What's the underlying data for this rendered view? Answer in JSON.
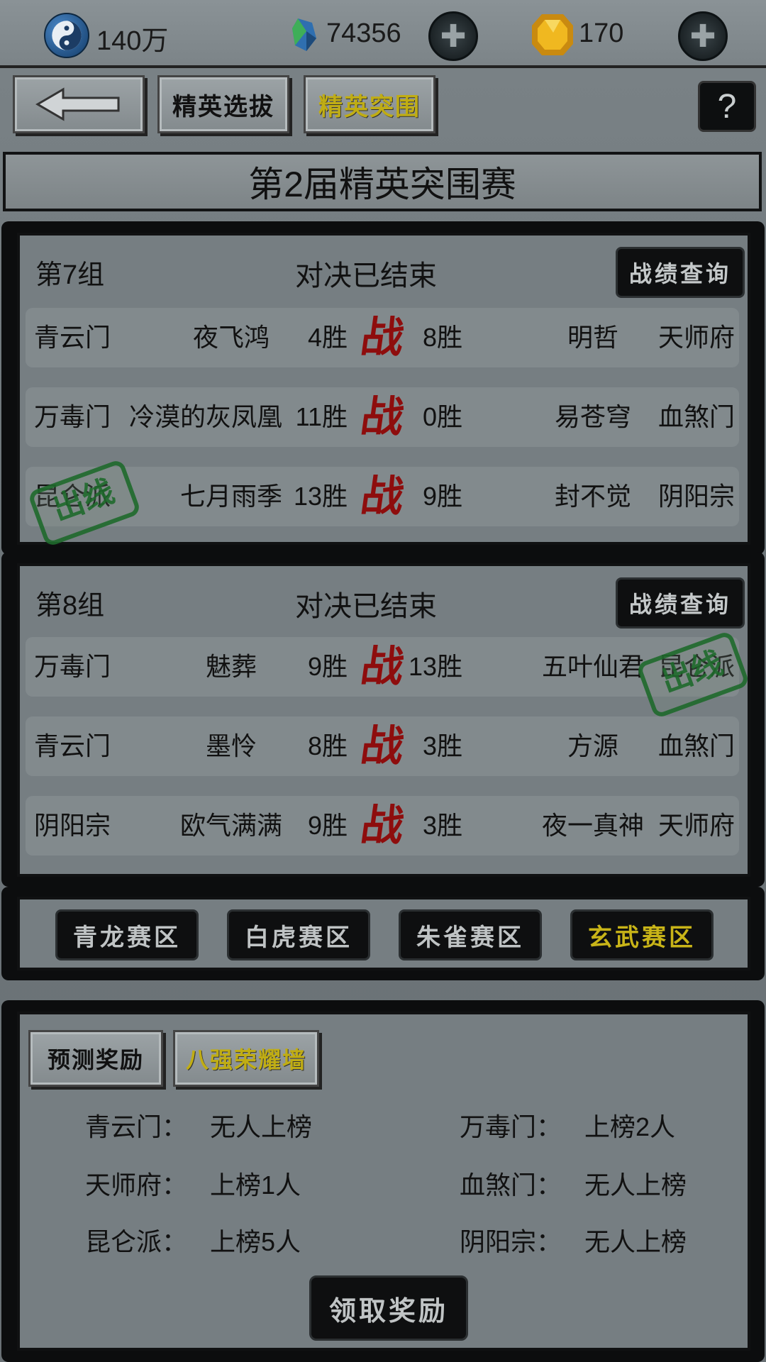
{
  "currencies": {
    "silver": {
      "icon": "yin-yang-coin-icon",
      "value": "140万"
    },
    "jade": {
      "icon": "blue-jade-icon",
      "value": "74356"
    },
    "gold": {
      "icon": "gold-ingot-icon",
      "value": "170"
    }
  },
  "nav": {
    "back_icon": "back-arrow-icon",
    "elite_select": "精英选拔",
    "elite_breakout": "精英突围",
    "help": "?"
  },
  "title": "第2届精英突围赛",
  "groups": [
    {
      "label": "第7组",
      "status": "对决已结束",
      "query": "战绩查询",
      "matches": [
        {
          "l_sect": "青云门",
          "l_name": "夜飞鸿",
          "l_wins": "4胜",
          "vs": "战",
          "r_wins": "8胜",
          "r_name": "明哲",
          "r_sect": "天师府"
        },
        {
          "l_sect": "万毒门",
          "l_name": "冷漠的灰凤凰",
          "l_wins": "11胜",
          "vs": "战",
          "r_wins": "0胜",
          "r_name": "易苍穹",
          "r_sect": "血煞门"
        },
        {
          "l_sect": "昆仑派",
          "l_name": "七月雨季",
          "l_wins": "13胜",
          "vs": "战",
          "r_wins": "9胜",
          "r_name": "封不觉",
          "r_sect": "阴阳宗",
          "stamp": "出线",
          "stamp_side": "left"
        }
      ]
    },
    {
      "label": "第8组",
      "status": "对决已结束",
      "query": "战绩查询",
      "matches": [
        {
          "l_sect": "万毒门",
          "l_name": "魅葬",
          "l_wins": "9胜",
          "vs": "战",
          "r_wins": "13胜",
          "r_name": "五叶仙君",
          "r_sect": "昆仑派",
          "stamp": "出线",
          "stamp_side": "right"
        },
        {
          "l_sect": "青云门",
          "l_name": "墨怜",
          "l_wins": "8胜",
          "vs": "战",
          "r_wins": "3胜",
          "r_name": "方源",
          "r_sect": "血煞门"
        },
        {
          "l_sect": "阴阳宗",
          "l_name": "欧气满满",
          "l_wins": "9胜",
          "vs": "战",
          "r_wins": "3胜",
          "r_name": "夜一真神",
          "r_sect": "天师府"
        }
      ]
    }
  ],
  "regions": [
    "青龙赛区",
    "白虎赛区",
    "朱雀赛区",
    "玄武赛区"
  ],
  "active_region": "玄武赛区",
  "reward": {
    "tabs": [
      "预测奖励",
      "八强荣耀墙"
    ],
    "rows": [
      {
        "l_label": "青云门：",
        "l_value": "无人上榜",
        "r_label": "万毒门：",
        "r_value": "上榜2人"
      },
      {
        "l_label": "天师府：",
        "l_value": "上榜1人",
        "r_label": "血煞门：",
        "r_value": "无人上榜"
      },
      {
        "l_label": "昆仑派：",
        "l_value": "上榜5人",
        "r_label": "阴阳宗：",
        "r_value": "无人上榜"
      }
    ],
    "claim": "领取奖励"
  },
  "colors": {
    "vs_red": "#8e0d0d",
    "stamp_green": "#1f6a2c",
    "active_gold": "#c8b418"
  }
}
